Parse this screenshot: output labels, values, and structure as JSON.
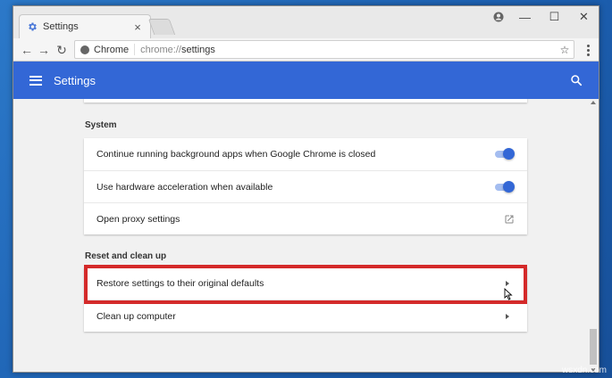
{
  "browser": {
    "tab_title": "Settings",
    "tab_close": "×",
    "omnibox_site": "Chrome",
    "url_scheme": "chrome://",
    "url_path": "settings",
    "star": "☆",
    "win_minimize": "—",
    "win_maximize": "☐",
    "win_close": "✕"
  },
  "nav": {
    "back": "←",
    "forward": "→",
    "reload": "↻"
  },
  "appbar": {
    "title": "Settings"
  },
  "system": {
    "title": "System",
    "items": [
      {
        "label": "Continue running background apps when Google Chrome is closed",
        "control": "toggle",
        "on": true
      },
      {
        "label": "Use hardware acceleration when available",
        "control": "toggle",
        "on": true
      },
      {
        "label": "Open proxy settings",
        "control": "external-link-icon"
      }
    ]
  },
  "reset": {
    "title": "Reset and clean up",
    "items": [
      {
        "label": "Restore settings to their original defaults",
        "control": "chevron-right-icon"
      },
      {
        "label": "Clean up computer",
        "control": "chevron-right-icon"
      }
    ]
  },
  "watermark": "wsxdn.com",
  "colors": {
    "accent": "#3367d6",
    "highlight": "#d42a2a",
    "toggle_track": "#a4bdf0"
  }
}
